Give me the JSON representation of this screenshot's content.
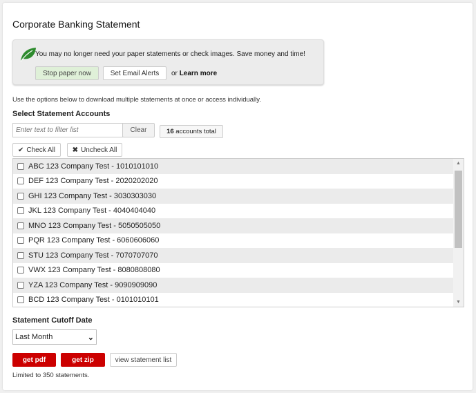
{
  "title": "Corporate Banking Statement",
  "promo": {
    "text": "You may no longer need your paper statements or check images. Save money and time!",
    "stop": "Stop paper now",
    "email": "Set Email Alerts",
    "or": "or",
    "learn": "Learn more"
  },
  "intro": "Use the options below to download multiple statements at once or access individually.",
  "select_label": "Select Statement Accounts",
  "filter_placeholder": "Enter text to filter list",
  "clear": "Clear",
  "total_count": "16",
  "total_suffix": " accounts total",
  "check_all": "Check All",
  "uncheck_all": "Uncheck All",
  "accounts": [
    "ABC 123 Company Test - 1010101010",
    "DEF 123 Company Test - 2020202020",
    "GHI 123 Company Test - 3030303030",
    "JKL 123 Company Test - 4040404040",
    "MNO 123 Company Test - 5050505050",
    "PQR 123 Company Test - 6060606060",
    "STU 123 Company Test - 7070707070",
    "VWX 123 Company Test - 8080808080",
    "YZA 123 Company Test - 9090909090",
    "BCD 123 Company Test - 0101010101"
  ],
  "cutoff_label": "Statement Cutoff Date",
  "cutoff_value": "Last Month",
  "get_pdf": "get pdf",
  "get_zip": "get zip",
  "view_list": "view statement list",
  "limit": "Limited to 350 statements."
}
